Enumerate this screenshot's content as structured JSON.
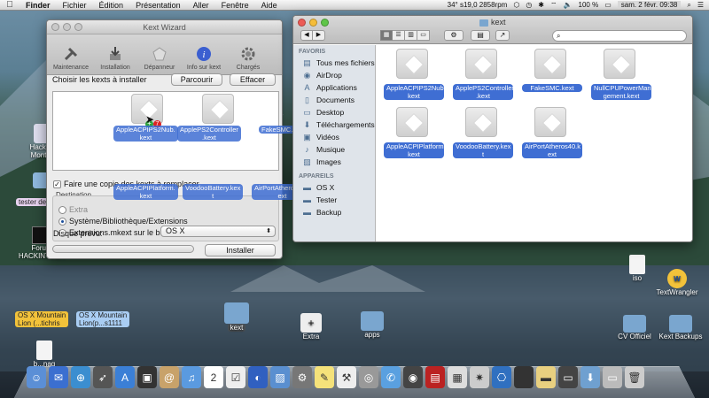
{
  "menubar": {
    "items": [
      "Finder",
      "Fichier",
      "Édition",
      "Présentation",
      "Aller",
      "Fenêtre",
      "Aide"
    ],
    "weather": "34° s19,0 2858rpm",
    "battery": "100 %",
    "clock": "sam. 2 févr. 09:38"
  },
  "kext_wizard": {
    "title": "Kext Wizard",
    "toolbar": [
      "Maintenance",
      "Installation",
      "Dépanneur",
      "Info sur kext",
      "Chargés"
    ],
    "choose_label": "Choisir les kexts à installer",
    "browse": "Parcourir",
    "clear": "Effacer",
    "kexts": [
      "AppleACPIPS2Nub.\nkext",
      "AppleACPIPS2Nub.\nkext",
      "AppleACPIPS2Nub.\nkext",
      "AppleACPIPS2Nub.\nkext"
    ],
    "drop_labels": [
      "AppleACPIPS2Nub.\nkext",
      "ApplePS2Controller\n.kext",
      "FakeSMC.kext",
      "NullCPUPowerMana\ngement.kext",
      "AppleACPIPlatform.\nkext",
      "VoodooBattery.kex\nt",
      "AirPortAtheros40.k\next"
    ],
    "copy_checkbox": "Faire une copie des kexts à remplacer",
    "copy_checked": true,
    "destination_label": "Destination",
    "destinations": [
      "Extra",
      "Système/Bibliothèque/Extensions",
      "Extensions.mkext sur le bureau"
    ],
    "destination_selected": 1,
    "disk_label": "Disque prévu:",
    "disk_value": "OS X",
    "install": "Installer",
    "install_progress": 0
  },
  "finder": {
    "title": "kext",
    "search_placeholder": "",
    "sidebar": {
      "favorites_head": "FAVORIS",
      "favorites": [
        "Tous mes fichiers",
        "AirDrop",
        "Applications",
        "Documents",
        "Desktop",
        "Téléchargements",
        "Vidéos",
        "Musique",
        "Images"
      ],
      "devices_head": "APPAREILS",
      "devices": [
        "OS X",
        "Tester",
        "Backup"
      ]
    },
    "files": [
      "AppleACPIPS2Nub.\nkext",
      "ApplePS2Controller\n.kext",
      "FakeSMC.kext",
      "NullCPUPowerMana\ngement.kext",
      "AppleACPIPlatform.\nkext",
      "VoodooBattery.kex\nt",
      "AirPortAtheros40.k\next"
    ]
  },
  "desktop": {
    "left": [
      "Hacking\nMontr...",
      "tester de...",
      "Forum\nHACKINTOSH"
    ],
    "tags": [
      "OS X Mountain\nLion (...tichris",
      "OS X Mountain\nLion(p...s1111"
    ],
    "folders": [
      "kext",
      "Extra",
      "apps"
    ],
    "right": [
      "iso",
      "TextWrangler",
      "CV Officiel",
      "Kext Backups"
    ],
    "file_bottom": "b...nag"
  },
  "colors": {
    "accent": "#3f6ed3",
    "selection": "#3f6ed3"
  }
}
